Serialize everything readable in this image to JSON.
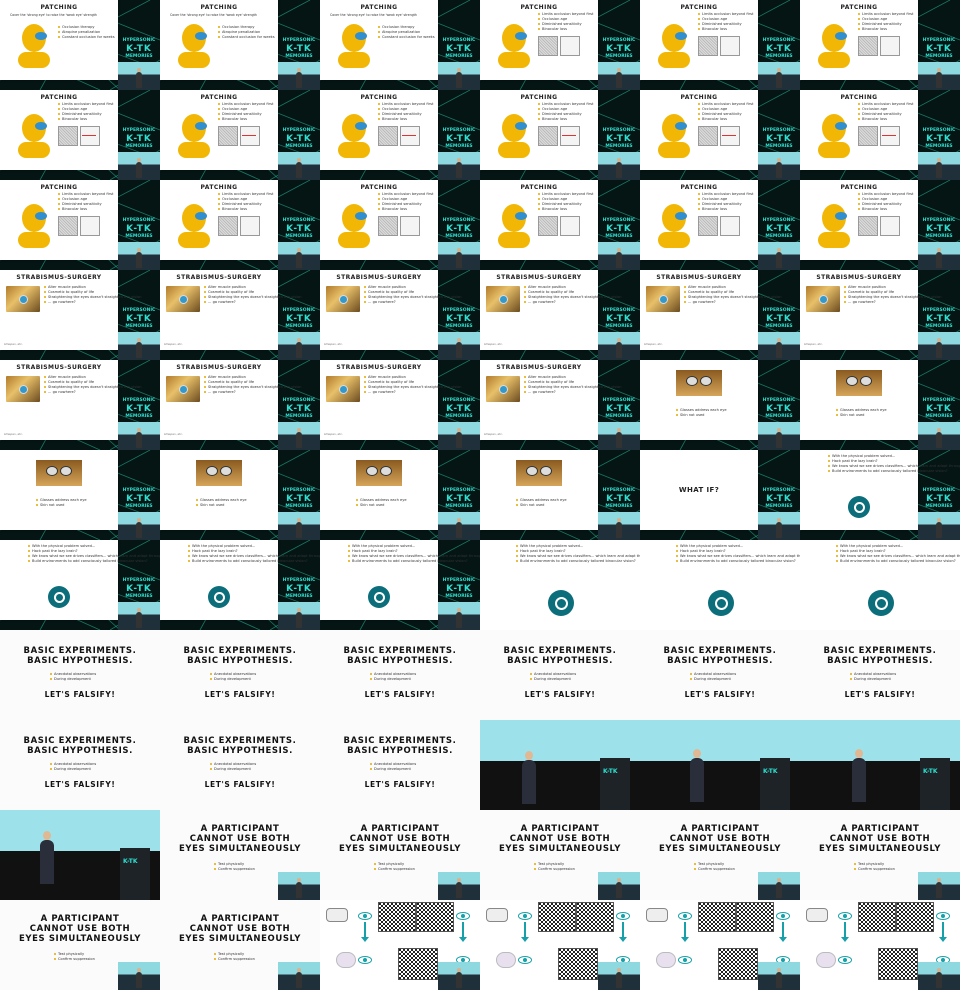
{
  "grid": {
    "cols": 6,
    "rows": 11
  },
  "logo": {
    "line1": "HYPERSONIC",
    "line2": "K-TK",
    "line3": "MEMORIES"
  },
  "slides": {
    "patching": {
      "title": "PATCHING",
      "intro": "Cover the 'strong eye' to raise the 'weak eye' strength",
      "bullets_a": [
        "Occlusion therapy",
        "Atropine penalization",
        "Constant occlusion for weeks"
      ],
      "bullets_b": [
        "Limits occlusion beyond first",
        "Occlusion age",
        "Diminished sensitivity",
        "Binocular loss"
      ]
    },
    "strabismus": {
      "title": "STRABISMUS-SURGERY",
      "bullets": [
        "Alter muscle position",
        "Cosmetic to quality of life",
        "Straightening the eyes doesn't straighten the vision",
        "... go nowhere?"
      ],
      "caption": "Lifespan, etc."
    },
    "glasses": {
      "bullets": [
        "Glasses address each eye",
        "Skin not used"
      ]
    },
    "whatif": {
      "title": "WHAT IF?"
    },
    "physical": {
      "bullets": [
        "With the physical problem solved...",
        "Hack past the lazy brain?",
        "We know what we see drives classifiers... which learn and adapt through training!",
        "Build environments to add consciously tailored binocular vision?"
      ]
    },
    "basic": {
      "title1": "BASIC EXPERIMENTS.",
      "title2": "BASIC HYPOTHESIS.",
      "bullets": [
        "Anecdotal observations",
        "During development"
      ],
      "footer": "LET'S FALSIFY!"
    },
    "participant": {
      "title1": "A PARTICIPANT",
      "title2": "CANNOT USE BOTH",
      "title3": "EYES SIMULTANEOUSLY",
      "bullets": [
        "Test physically",
        "Confirm suppression"
      ]
    }
  },
  "tiles": [
    "patch1",
    "patch1",
    "patch1",
    "patch2",
    "patch2",
    "patch2",
    "patch3",
    "patch3",
    "patch3",
    "patch3",
    "patch3",
    "patch3",
    "patch4",
    "patch4",
    "patch4",
    "patch4",
    "patch4",
    "patch4",
    "strab",
    "strab",
    "strab",
    "strab",
    "strab",
    "strab",
    "strab",
    "strab",
    "strab",
    "strab",
    "glass",
    "glass",
    "glass",
    "glass",
    "glass",
    "glass",
    "whatif",
    "phys1",
    "phys2",
    "phys2",
    "phys2",
    "phys3",
    "phys3",
    "phys3",
    "basic",
    "basic",
    "basic",
    "basic",
    "basic",
    "basic",
    "basic",
    "basic",
    "basic",
    "stage1",
    "stage2",
    "stage3",
    "stage4",
    "part",
    "part",
    "part",
    "part",
    "part",
    "part",
    "part",
    "vr",
    "vr",
    "vr",
    "vr"
  ]
}
